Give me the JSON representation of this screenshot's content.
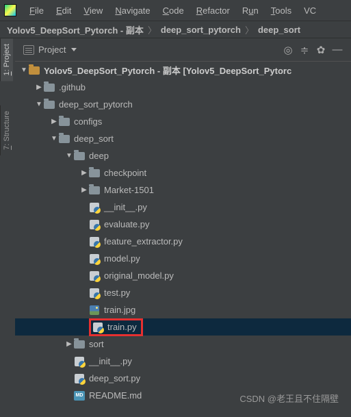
{
  "menu": {
    "items": [
      "File",
      "Edit",
      "View",
      "Navigate",
      "Code",
      "Refactor",
      "Run",
      "Tools",
      "VC"
    ]
  },
  "breadcrumb": {
    "items": [
      "Yolov5_DeepSort_Pytorch - 副本",
      "deep_sort_pytorch",
      "deep_sort"
    ]
  },
  "project_panel": {
    "label": "Project"
  },
  "side": {
    "tab1": "1: Project",
    "tab2": "7: Structure"
  },
  "tree": {
    "root_name": "Yolov5_DeepSort_Pytorch - 副本",
    "root_suffix": " [Yolov5_DeepSort_Pytorc",
    "github": ".github",
    "dsp": "deep_sort_pytorch",
    "configs": "configs",
    "deep_sort": "deep_sort",
    "deep": "deep",
    "checkpoint": "checkpoint",
    "market": "Market-1501",
    "init_py": "__init__.py",
    "evaluate": "evaluate.py",
    "fe": "feature_extractor.py",
    "model": "model.py",
    "orig": "original_model.py",
    "test": "test.py",
    "trainjpg": "train.jpg",
    "trainpy": "train.py",
    "sort": "sort",
    "init2": "__init__.py",
    "ds": "deep_sort.py",
    "readme": "README.md",
    "md_label": "MD"
  },
  "watermark": "CSDN @老王且不住隔壁"
}
